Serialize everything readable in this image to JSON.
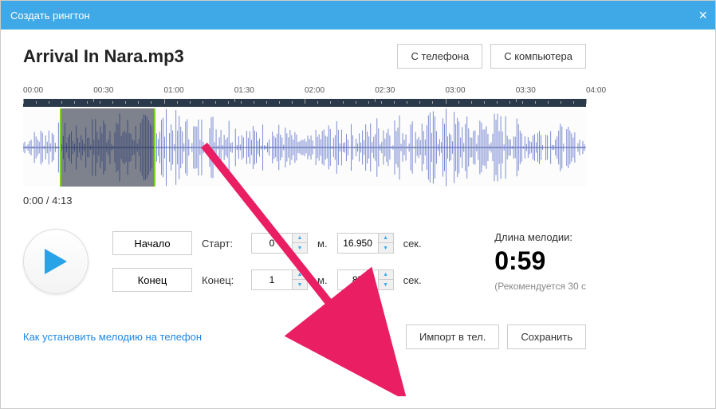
{
  "titlebar": {
    "title": "Создать рингтон"
  },
  "file": {
    "name": "Arrival In Nara.mp3"
  },
  "top_buttons": {
    "from_phone": "С телефона",
    "from_computer": "С компьютера"
  },
  "timeline": {
    "ticks": [
      "00:00",
      "00:30",
      "01:00",
      "01:30",
      "02:00",
      "02:30",
      "03:00",
      "03:30",
      "04:00"
    ],
    "selection": {
      "start_pct": 6.5,
      "end_pct": 23.5
    }
  },
  "counter": "0:00 / 4:13",
  "controls": {
    "start_btn": "Начало",
    "end_btn": "Конец",
    "start_label": "Старт:",
    "end_label": "Конец:",
    "start_min": "0",
    "start_sec": "16.950",
    "end_min": "1",
    "end_sec": "85",
    "unit_min": "м.",
    "unit_sec": "сек."
  },
  "duration": {
    "label": "Длина мелодии:",
    "value": "0:59",
    "rec": "(Рекомендуется 30 с"
  },
  "bottom": {
    "help": "Как установить мелодию на телефон",
    "import": "Импорт в тел.",
    "save": "Сохранить"
  }
}
